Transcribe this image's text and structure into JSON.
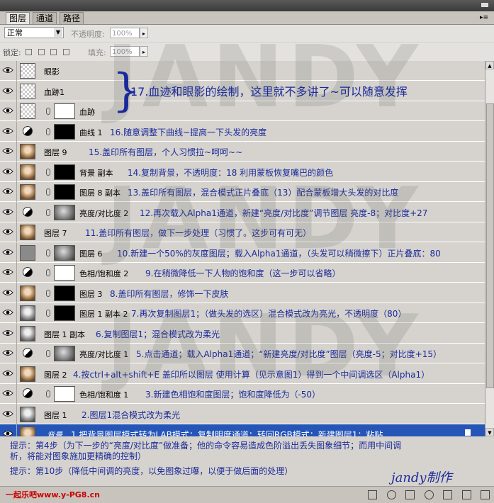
{
  "panel": {
    "tabs": [
      "图层",
      "通道",
      "路径"
    ],
    "blend_mode": "正常",
    "opacity_label": "不透明度:",
    "opacity_value": "100%",
    "lock_label": "锁定:",
    "fill_label": "填充:",
    "fill_value": "100%"
  },
  "watermark": [
    "JANDY",
    "JANDY",
    "JANDY"
  ],
  "annotation_17": "17.血迹和眼影的绘制，这里就不多讲了~可以随意发挥",
  "layers": [
    {
      "name": "眼影",
      "note": ""
    },
    {
      "name": "血跡1",
      "note": ""
    },
    {
      "name": "血跡",
      "note": ""
    },
    {
      "name": "曲线 1",
      "note": "16.随意调整下曲线~提高一下头发的亮度"
    },
    {
      "name": "图层 9",
      "note": "15.盖印所有图层，个人习惯拉~呵呵~~"
    },
    {
      "name": "背景 副本",
      "note": "14.复制背景，不透明度：18  利用蒙板恢复嘴巴的颜色"
    },
    {
      "name": "图层 8 副本",
      "note": "13.盖印所有图层，混合模式正片叠底（13）配合蒙板增大头发的对比度"
    },
    {
      "name": "亮度/对比度 2",
      "note": "12.再次载入Alpha1通道，新建“亮度/对比度”调节图层  亮度-8；对比度+27"
    },
    {
      "name": "图层 7",
      "note": "11.盖印所有图层，做下一步处理（习惯了。这步可有可无）"
    },
    {
      "name": "图层 6",
      "note": "10.新建一个50%的灰度图层；载入Alpha1通道，（头发可以稍微擦下）正片叠底：80"
    },
    {
      "name": "色相/饱和度 2",
      "note": "9.在稍微降低一下人物的饱和度（这一步可以省略）"
    },
    {
      "name": "图层 3",
      "note": "8.盖印所有图层，修饰一下皮肤"
    },
    {
      "name": "图层 1 副本 2",
      "note": "7.再次复制图层1；（做头发的选区）混合模式改为亮光，不透明度（80）"
    },
    {
      "name": "图层 1 副本",
      "note": "6.复制图层1；混合模式改为柔光"
    },
    {
      "name": "亮度/对比度 1",
      "note": "5.点击通道；载入Alpha1通道；“新建亮度/对比度”图层（亮度-5；对比度+15）"
    },
    {
      "name": "图层 2",
      "note": "4.按ctrl+alt+shift+E 盖印所以图层  使用计算（见示意图1）得到一个中间调选区（Alpha1）"
    },
    {
      "name": "色相/饱和度 1",
      "note": "3.新建色相饱和度图层；饱和度降低为（-50）"
    },
    {
      "name": "图层 1",
      "note": "2.图层1混合模式改为柔光"
    },
    {
      "name": "背景",
      "note": "1.把背景图层模式转为LAB模式；复制明度通道；转回RGB模式；新建图层1；粘贴"
    }
  ],
  "tips": [
    "提示：第4步（为下一步的“亮度/对比度”做准备；他的命令容易造成色阶溢出丢失图象细节；而用中间调",
    "析，将能对图象施加更精确的控制）",
    "提示：第10步（降低中间调的亮度，以免图象过曝，以便于做后面的处理）"
  ],
  "signature": "jandy制作",
  "brand": "一起乐吧www.y-PG8.cn"
}
